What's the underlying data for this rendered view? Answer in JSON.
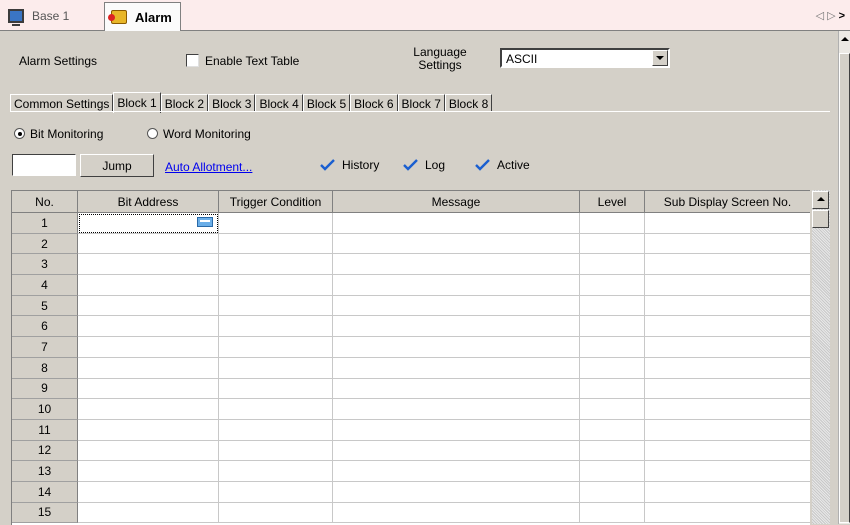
{
  "doc_tabs": [
    {
      "label": "Base 1",
      "icon": "monitor-icon",
      "active": false
    },
    {
      "label": "Alarm",
      "icon": "alarm-icon",
      "active": true
    }
  ],
  "doc_nav": {
    "prev": "◁",
    "next": "▷",
    "more": ">"
  },
  "settings": {
    "alarm_settings_label": "Alarm Settings",
    "enable_text_table_label": "Enable Text Table",
    "enable_text_table_checked": false,
    "language_label": "Language Settings",
    "language_value": "ASCII"
  },
  "block_tabs": [
    "Common Settings",
    "Block 1",
    "Block 2",
    "Block 3",
    "Block 4",
    "Block 5",
    "Block 6",
    "Block 7",
    "Block 8"
  ],
  "active_block_tab": "Block 1",
  "monitoring": {
    "bit_label": "Bit Monitoring",
    "word_label": "Word Monitoring",
    "selected": "bit"
  },
  "toolbar": {
    "jump_value": "",
    "jump_label": "Jump",
    "auto_allotment_label": "Auto Allotment...",
    "history_label": "History",
    "log_label": "Log",
    "active_label": "Active",
    "check_color": "#1a5fd0"
  },
  "grid": {
    "headers": [
      "No.",
      "Bit Address",
      "Trigger Condition",
      "Message",
      "Level",
      "Sub Display Screen No."
    ],
    "rows": [
      "1",
      "2",
      "3",
      "4",
      "5",
      "6",
      "7",
      "8",
      "9",
      "10",
      "11",
      "12",
      "13",
      "14",
      "15"
    ]
  }
}
